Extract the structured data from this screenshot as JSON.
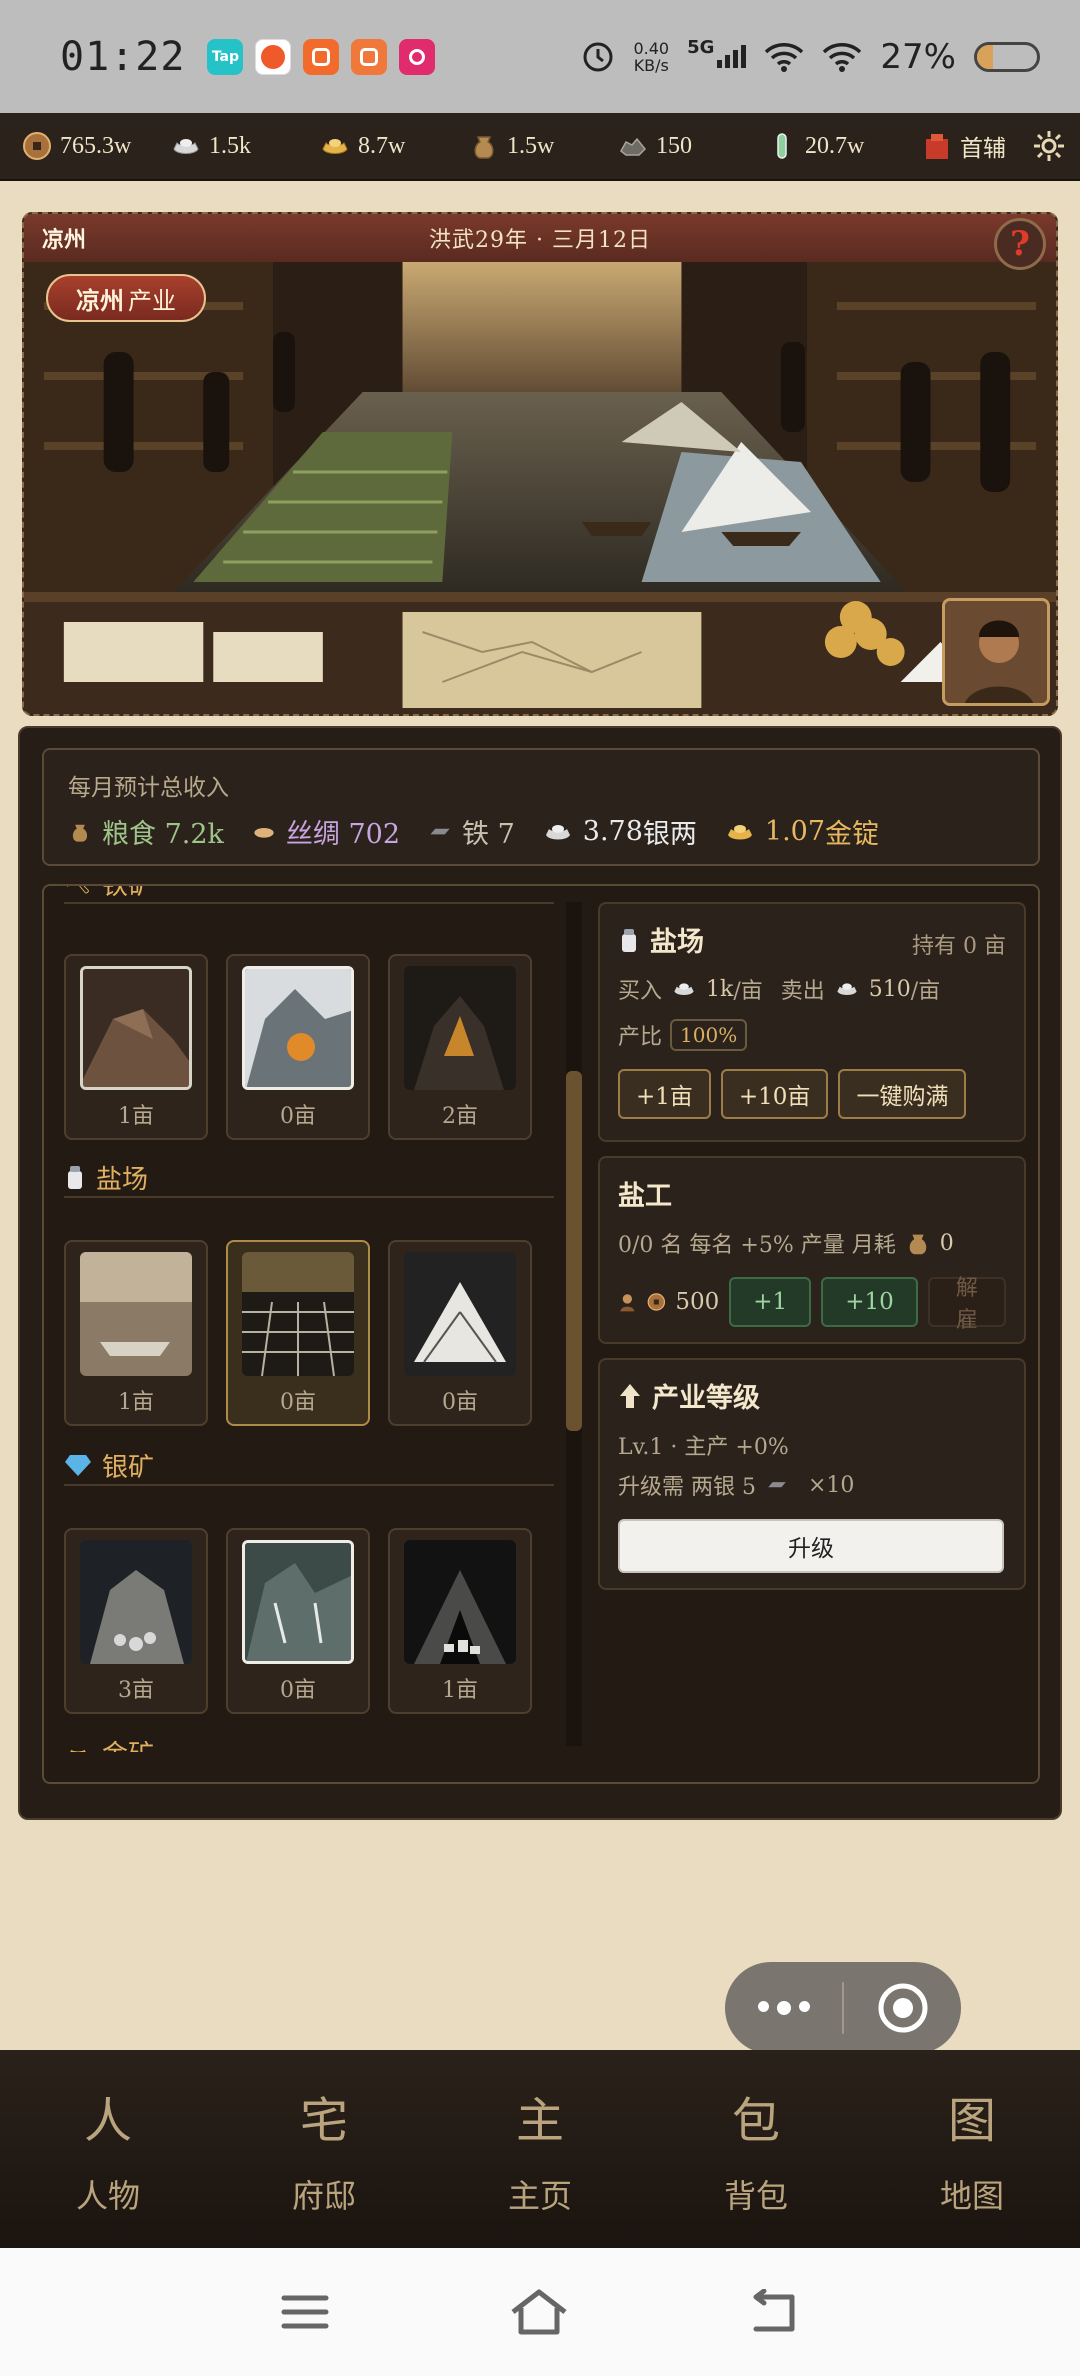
{
  "status_bar": {
    "time": "01:22",
    "net_speed_value": "0.40",
    "net_speed_unit": "KB/s",
    "network": "5G",
    "battery_pct": "27%",
    "battery_level": 0.27
  },
  "resources": [
    {
      "icon": "copper-coin-icon",
      "value": "765.3w"
    },
    {
      "icon": "silver-ingot-icon",
      "value": "1.5k"
    },
    {
      "icon": "gold-ingot-icon",
      "value": "8.7w"
    },
    {
      "icon": "grain-sack-icon",
      "value": "1.5w"
    },
    {
      "icon": "iron-ore-icon",
      "value": "150"
    },
    {
      "icon": "jade-icon",
      "value": "20.7w"
    }
  ],
  "rank_label": "首辅",
  "banner": {
    "location": "凉州",
    "date": "洪武29年 · 三月12日",
    "help_glyph": "?",
    "region_name": "凉州",
    "region_suffix": "产业"
  },
  "income": {
    "title": "每月预计总收入",
    "items": [
      {
        "label": "粮食 7.2k",
        "color": "#9fc48a"
      },
      {
        "label": "丝绸 702",
        "color": "#c7a5e0"
      },
      {
        "label": "铁 7",
        "color": "#c9c0b0"
      }
    ],
    "silver_value": "3.78",
    "silver_unit": "银两",
    "gold_value": "1.07",
    "gold_unit": "金锭"
  },
  "sections": [
    {
      "name": "铁矿",
      "tiles": [
        {
          "count": "1亩"
        },
        {
          "count": "0亩"
        },
        {
          "count": "2亩"
        }
      ]
    },
    {
      "name": "盐场",
      "tiles": [
        {
          "count": "1亩"
        },
        {
          "count": "0亩"
        },
        {
          "count": "0亩"
        }
      ]
    },
    {
      "name": "银矿",
      "tiles": [
        {
          "count": "3亩"
        },
        {
          "count": "0亩"
        },
        {
          "count": "1亩"
        }
      ]
    },
    {
      "name": "金矿"
    }
  ],
  "scroll_position": 0.35,
  "salt_card": {
    "title": "盐场",
    "hold": "持有 0 亩",
    "buy_label": "买入",
    "buy_value": "1k",
    "buy_unit": "/亩",
    "sell_label": "卖出",
    "sell_value": "510",
    "sell_unit": "/亩",
    "ratio_label": "产比",
    "ratio_value": "100%",
    "buttons": [
      "+1亩",
      "+10亩",
      "一键购满"
    ]
  },
  "worker_card": {
    "title": "盐工",
    "info": "0/0 名  每名 +5% 产量  月耗",
    "upkeep": "0",
    "cost": "500",
    "buttons": [
      "+1",
      "+10"
    ],
    "fire_label": "解雇"
  },
  "level_card": {
    "title": "产业等级",
    "level": "Lv.1 · 主产 +0%",
    "need_text": "升级需 两银 5",
    "need_mult": "×10",
    "upgrade_label": "升级"
  },
  "nav": [
    {
      "glyph": "人",
      "label": "人物"
    },
    {
      "glyph": "宅",
      "label": "府邸"
    },
    {
      "glyph": "主",
      "label": "主页"
    },
    {
      "glyph": "包",
      "label": "背包"
    },
    {
      "glyph": "图",
      "label": "地图"
    }
  ]
}
